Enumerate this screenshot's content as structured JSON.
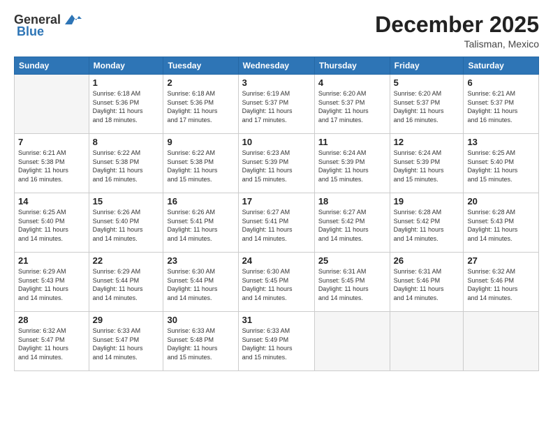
{
  "logo": {
    "general": "General",
    "blue": "Blue"
  },
  "title": "December 2025",
  "location": "Talisman, Mexico",
  "days_of_week": [
    "Sunday",
    "Monday",
    "Tuesday",
    "Wednesday",
    "Thursday",
    "Friday",
    "Saturday"
  ],
  "weeks": [
    [
      {
        "day": "",
        "info": ""
      },
      {
        "day": "1",
        "info": "Sunrise: 6:18 AM\nSunset: 5:36 PM\nDaylight: 11 hours\nand 18 minutes."
      },
      {
        "day": "2",
        "info": "Sunrise: 6:18 AM\nSunset: 5:36 PM\nDaylight: 11 hours\nand 17 minutes."
      },
      {
        "day": "3",
        "info": "Sunrise: 6:19 AM\nSunset: 5:37 PM\nDaylight: 11 hours\nand 17 minutes."
      },
      {
        "day": "4",
        "info": "Sunrise: 6:20 AM\nSunset: 5:37 PM\nDaylight: 11 hours\nand 17 minutes."
      },
      {
        "day": "5",
        "info": "Sunrise: 6:20 AM\nSunset: 5:37 PM\nDaylight: 11 hours\nand 16 minutes."
      },
      {
        "day": "6",
        "info": "Sunrise: 6:21 AM\nSunset: 5:37 PM\nDaylight: 11 hours\nand 16 minutes."
      }
    ],
    [
      {
        "day": "7",
        "info": "Sunrise: 6:21 AM\nSunset: 5:38 PM\nDaylight: 11 hours\nand 16 minutes."
      },
      {
        "day": "8",
        "info": "Sunrise: 6:22 AM\nSunset: 5:38 PM\nDaylight: 11 hours\nand 16 minutes."
      },
      {
        "day": "9",
        "info": "Sunrise: 6:22 AM\nSunset: 5:38 PM\nDaylight: 11 hours\nand 15 minutes."
      },
      {
        "day": "10",
        "info": "Sunrise: 6:23 AM\nSunset: 5:39 PM\nDaylight: 11 hours\nand 15 minutes."
      },
      {
        "day": "11",
        "info": "Sunrise: 6:24 AM\nSunset: 5:39 PM\nDaylight: 11 hours\nand 15 minutes."
      },
      {
        "day": "12",
        "info": "Sunrise: 6:24 AM\nSunset: 5:39 PM\nDaylight: 11 hours\nand 15 minutes."
      },
      {
        "day": "13",
        "info": "Sunrise: 6:25 AM\nSunset: 5:40 PM\nDaylight: 11 hours\nand 15 minutes."
      }
    ],
    [
      {
        "day": "14",
        "info": "Sunrise: 6:25 AM\nSunset: 5:40 PM\nDaylight: 11 hours\nand 14 minutes."
      },
      {
        "day": "15",
        "info": "Sunrise: 6:26 AM\nSunset: 5:40 PM\nDaylight: 11 hours\nand 14 minutes."
      },
      {
        "day": "16",
        "info": "Sunrise: 6:26 AM\nSunset: 5:41 PM\nDaylight: 11 hours\nand 14 minutes."
      },
      {
        "day": "17",
        "info": "Sunrise: 6:27 AM\nSunset: 5:41 PM\nDaylight: 11 hours\nand 14 minutes."
      },
      {
        "day": "18",
        "info": "Sunrise: 6:27 AM\nSunset: 5:42 PM\nDaylight: 11 hours\nand 14 minutes."
      },
      {
        "day": "19",
        "info": "Sunrise: 6:28 AM\nSunset: 5:42 PM\nDaylight: 11 hours\nand 14 minutes."
      },
      {
        "day": "20",
        "info": "Sunrise: 6:28 AM\nSunset: 5:43 PM\nDaylight: 11 hours\nand 14 minutes."
      }
    ],
    [
      {
        "day": "21",
        "info": "Sunrise: 6:29 AM\nSunset: 5:43 PM\nDaylight: 11 hours\nand 14 minutes."
      },
      {
        "day": "22",
        "info": "Sunrise: 6:29 AM\nSunset: 5:44 PM\nDaylight: 11 hours\nand 14 minutes."
      },
      {
        "day": "23",
        "info": "Sunrise: 6:30 AM\nSunset: 5:44 PM\nDaylight: 11 hours\nand 14 minutes."
      },
      {
        "day": "24",
        "info": "Sunrise: 6:30 AM\nSunset: 5:45 PM\nDaylight: 11 hours\nand 14 minutes."
      },
      {
        "day": "25",
        "info": "Sunrise: 6:31 AM\nSunset: 5:45 PM\nDaylight: 11 hours\nand 14 minutes."
      },
      {
        "day": "26",
        "info": "Sunrise: 6:31 AM\nSunset: 5:46 PM\nDaylight: 11 hours\nand 14 minutes."
      },
      {
        "day": "27",
        "info": "Sunrise: 6:32 AM\nSunset: 5:46 PM\nDaylight: 11 hours\nand 14 minutes."
      }
    ],
    [
      {
        "day": "28",
        "info": "Sunrise: 6:32 AM\nSunset: 5:47 PM\nDaylight: 11 hours\nand 14 minutes."
      },
      {
        "day": "29",
        "info": "Sunrise: 6:33 AM\nSunset: 5:47 PM\nDaylight: 11 hours\nand 14 minutes."
      },
      {
        "day": "30",
        "info": "Sunrise: 6:33 AM\nSunset: 5:48 PM\nDaylight: 11 hours\nand 15 minutes."
      },
      {
        "day": "31",
        "info": "Sunrise: 6:33 AM\nSunset: 5:49 PM\nDaylight: 11 hours\nand 15 minutes."
      },
      {
        "day": "",
        "info": ""
      },
      {
        "day": "",
        "info": ""
      },
      {
        "day": "",
        "info": ""
      }
    ]
  ]
}
